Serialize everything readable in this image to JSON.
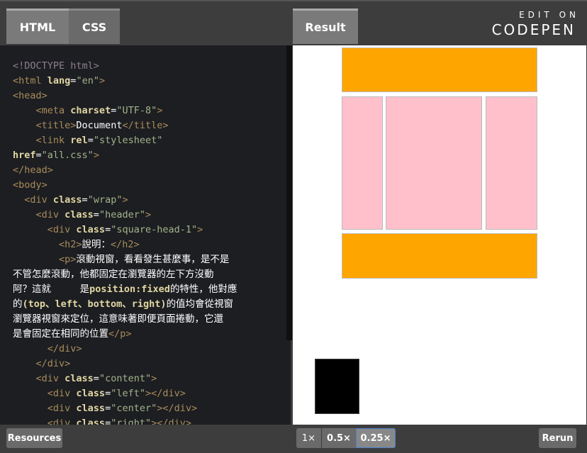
{
  "tabs": {
    "html": "HTML",
    "css": "CSS",
    "result": "Result"
  },
  "logo": {
    "top": "EDIT ON",
    "bottom": "CODEPEN"
  },
  "code_lines": [
    [
      [
        "dt",
        "<!DOCTYPE html>"
      ]
    ],
    [
      [
        "tg",
        "<html "
      ],
      [
        "at",
        "lang"
      ],
      [
        "tx",
        "="
      ],
      [
        "st",
        "\"en\""
      ],
      [
        "tg",
        ">"
      ]
    ],
    [
      [
        "tg",
        "<head>"
      ]
    ],
    [
      [
        "tx",
        "    "
      ],
      [
        "tg",
        "<meta "
      ],
      [
        "at",
        "charset"
      ],
      [
        "tx",
        "="
      ],
      [
        "st",
        "\"UTF-8\""
      ],
      [
        "tg",
        ">"
      ]
    ],
    [
      [
        "tx",
        "    "
      ],
      [
        "tg",
        "<title>"
      ],
      [
        "tx",
        "Document"
      ],
      [
        "tg",
        "</title>"
      ]
    ],
    [
      [
        "tx",
        "    "
      ],
      [
        "tg",
        "<link "
      ],
      [
        "at",
        "rel"
      ],
      [
        "tx",
        "="
      ],
      [
        "st",
        "\"stylesheet\""
      ]
    ],
    [
      [
        "at",
        "href"
      ],
      [
        "tx",
        "="
      ],
      [
        "st",
        "\"all.css\""
      ],
      [
        "tg",
        ">"
      ]
    ],
    [
      [
        "tg",
        "</head>"
      ]
    ],
    [
      [
        "tg",
        "<body>"
      ]
    ],
    [
      [
        "tx",
        "  "
      ],
      [
        "tg",
        "<div "
      ],
      [
        "at",
        "class"
      ],
      [
        "tx",
        "="
      ],
      [
        "st",
        "\"wrap\""
      ],
      [
        "tg",
        ">"
      ]
    ],
    [
      [
        "tx",
        "    "
      ],
      [
        "tg",
        "<div "
      ],
      [
        "at",
        "class"
      ],
      [
        "tx",
        "="
      ],
      [
        "st",
        "\"header\""
      ],
      [
        "tg",
        ">"
      ]
    ],
    [
      [
        "tx",
        "      "
      ],
      [
        "tg",
        "<div "
      ],
      [
        "at",
        "class"
      ],
      [
        "tx",
        "="
      ],
      [
        "st",
        "\"square-head-1\""
      ],
      [
        "tg",
        ">"
      ]
    ],
    [
      [
        "tx",
        "        "
      ],
      [
        "tg",
        "<h2>"
      ],
      [
        "tx",
        "說明："
      ],
      [
        "tg",
        "</h2>"
      ]
    ],
    [
      [
        "tx",
        "        "
      ],
      [
        "tg",
        "<p>"
      ],
      [
        "tx",
        "滾動視窗，看看發生甚麼事，是不是"
      ]
    ],
    [
      [
        "tx",
        "不管怎麼滾動，他都固定在瀏覽器的左下方沒動"
      ]
    ],
    [
      [
        "tx",
        "阿？這就     是"
      ],
      [
        "at",
        "position:fixed"
      ],
      [
        "tx",
        "的特性，他對應"
      ]
    ],
    [
      [
        "tx",
        "的"
      ],
      [
        "at",
        "(top、left、bottom、right)"
      ],
      [
        "tx",
        "的值均會從視窗"
      ]
    ],
    [
      [
        "tx",
        "瀏覽器視窗來定位，這意味著即便頁面捲動，它還"
      ]
    ],
    [
      [
        "tx",
        "是會固定在相同的位置"
      ],
      [
        "tg",
        "</p>"
      ]
    ],
    [
      [
        "tx",
        "      "
      ],
      [
        "tg",
        "</div>"
      ]
    ],
    [
      [
        "tx",
        "    "
      ],
      [
        "tg",
        "</div>"
      ]
    ],
    [
      [
        "tx",
        "    "
      ],
      [
        "tg",
        "<div "
      ],
      [
        "at",
        "class"
      ],
      [
        "tx",
        "="
      ],
      [
        "st",
        "\"content\""
      ],
      [
        "tg",
        ">"
      ]
    ],
    [
      [
        "tx",
        "      "
      ],
      [
        "tg",
        "<div "
      ],
      [
        "at",
        "class"
      ],
      [
        "tx",
        "="
      ],
      [
        "st",
        "\"left\""
      ],
      [
        "tg",
        "></div>"
      ]
    ],
    [
      [
        "tx",
        "      "
      ],
      [
        "tg",
        "<div "
      ],
      [
        "at",
        "class"
      ],
      [
        "tx",
        "="
      ],
      [
        "st",
        "\"center\""
      ],
      [
        "tg",
        "></div>"
      ]
    ],
    [
      [
        "tx",
        "      "
      ],
      [
        "tg",
        "<div "
      ],
      [
        "at",
        "class"
      ],
      [
        "tx",
        "="
      ],
      [
        "st",
        "\"right\""
      ],
      [
        "tg",
        "></div>"
      ]
    ]
  ],
  "bottom": {
    "resources": "Resources",
    "zoom": [
      "1×",
      "0.5×",
      "0.25×"
    ],
    "zoom_selected": "0.25×",
    "rerun": "Rerun"
  },
  "colors": {
    "orange": "#ffa500",
    "pink": "#ffc0cb",
    "editor_bg": "#1d1e22"
  }
}
